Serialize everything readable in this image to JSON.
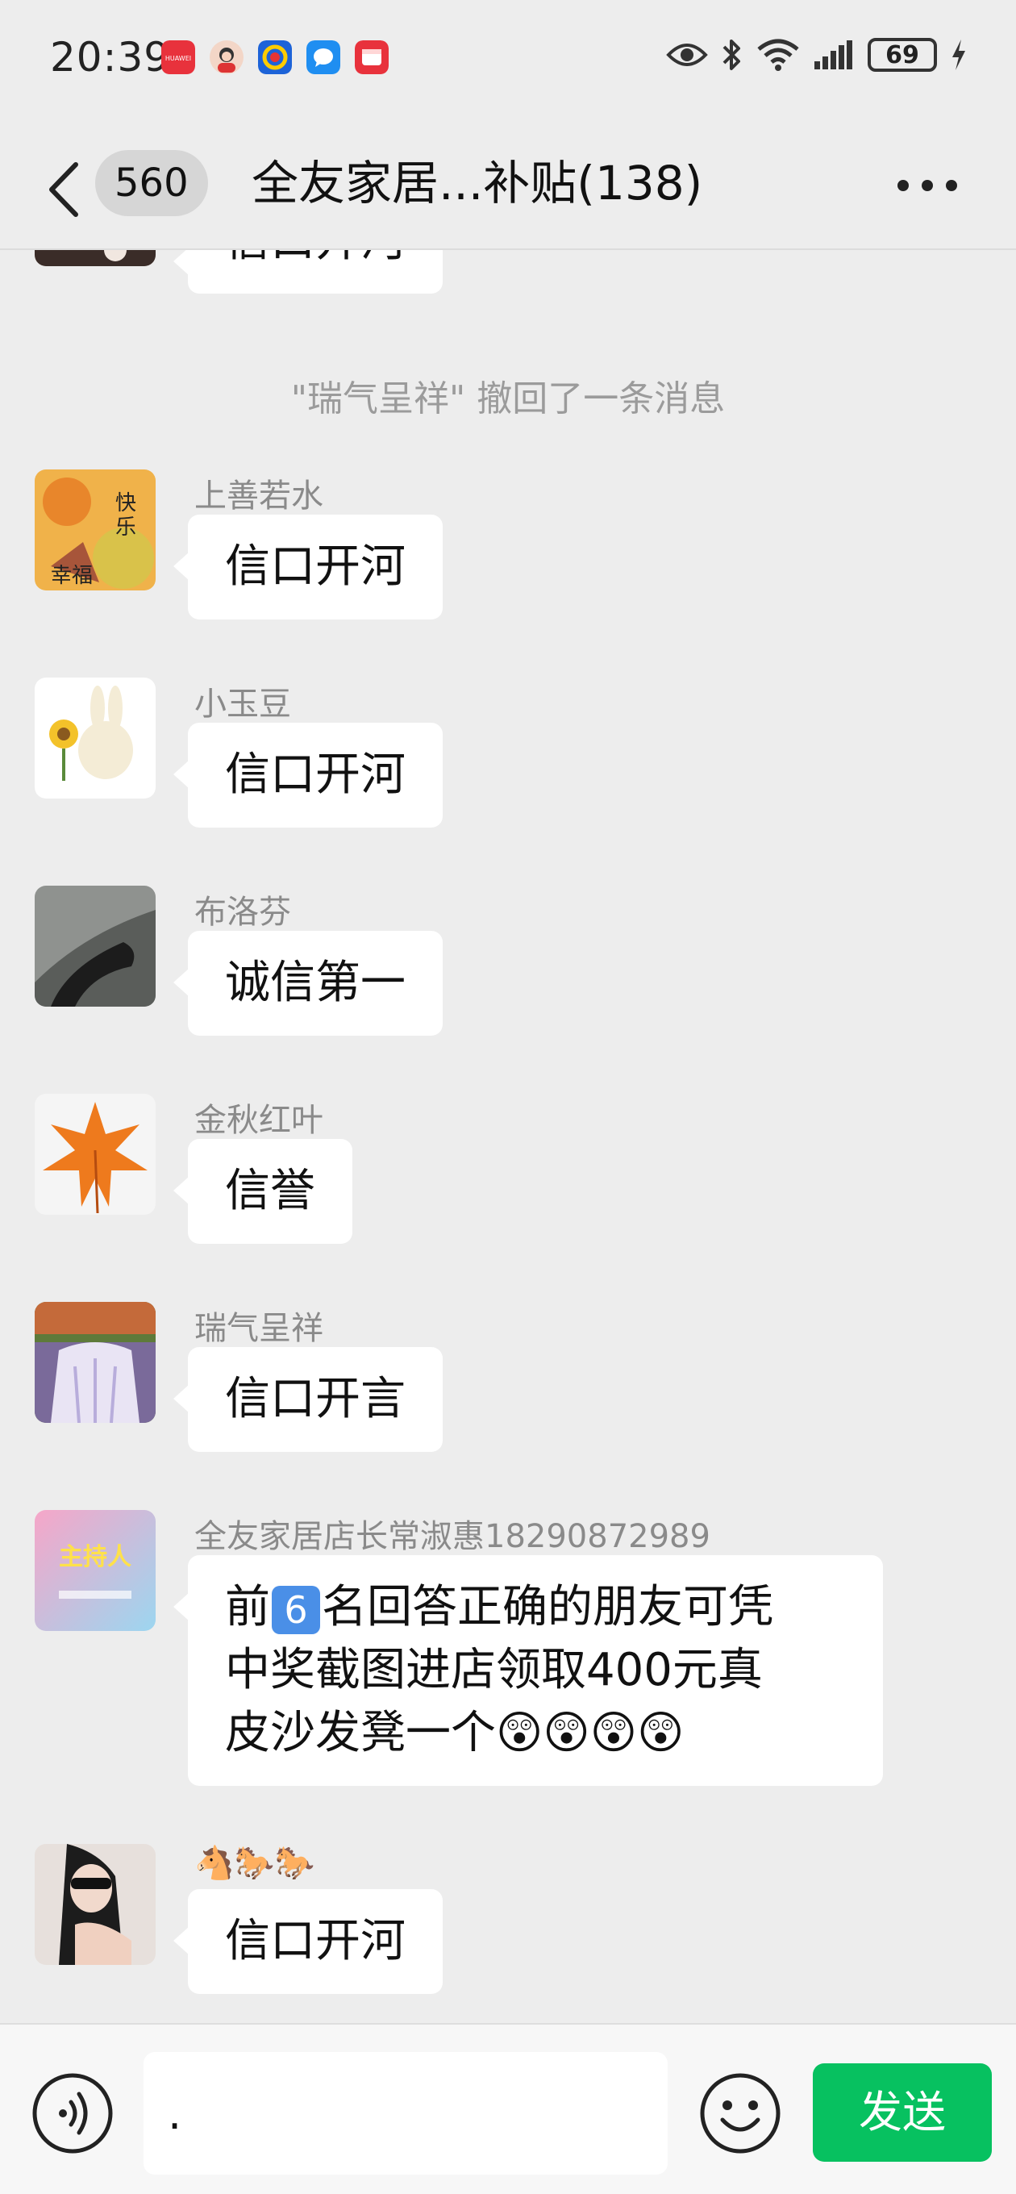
{
  "status_bar": {
    "time": "20:39",
    "battery": "69",
    "app_icons": [
      "huawei-appgallery-icon",
      "avatar-app-icon",
      "colorful-app-icon",
      "message-app-icon",
      "red-app-icon"
    ]
  },
  "header": {
    "unread_count": "560",
    "title": "全友家居...补贴(138)"
  },
  "messages": {
    "recall_notice": "\"瑞气呈祥\" 撤回了一条消息",
    "top_partial": {
      "text": "信口开河"
    },
    "items": [
      {
        "sender": "上善若水",
        "text": "信口开河"
      },
      {
        "sender": "小玉豆",
        "text": "信口开河"
      },
      {
        "sender": "布洛芬",
        "text": "诚信第一"
      },
      {
        "sender": "金秋红叶",
        "text": "信誉"
      },
      {
        "sender": "瑞气呈祥",
        "text": "信口开言"
      },
      {
        "sender": "全友家居店长常淑惠18290872989",
        "text_line1": "前",
        "number_emoji": "6",
        "text_line1b": "名回答正确的朋友可凭",
        "text_line2": "中奖截图进店领取400元真",
        "text_line3": "皮沙发凳一个",
        "emoji": "😲😲😲😲"
      },
      {
        "sender": "🐴🐎🐎",
        "text": "信口开河"
      }
    ]
  },
  "input_bar": {
    "value": ".",
    "send_label": "发送"
  },
  "colors": {
    "background": "#ededed",
    "bubble": "#ffffff",
    "send_button": "#07c160",
    "muted_text": "#8a8a8a"
  }
}
